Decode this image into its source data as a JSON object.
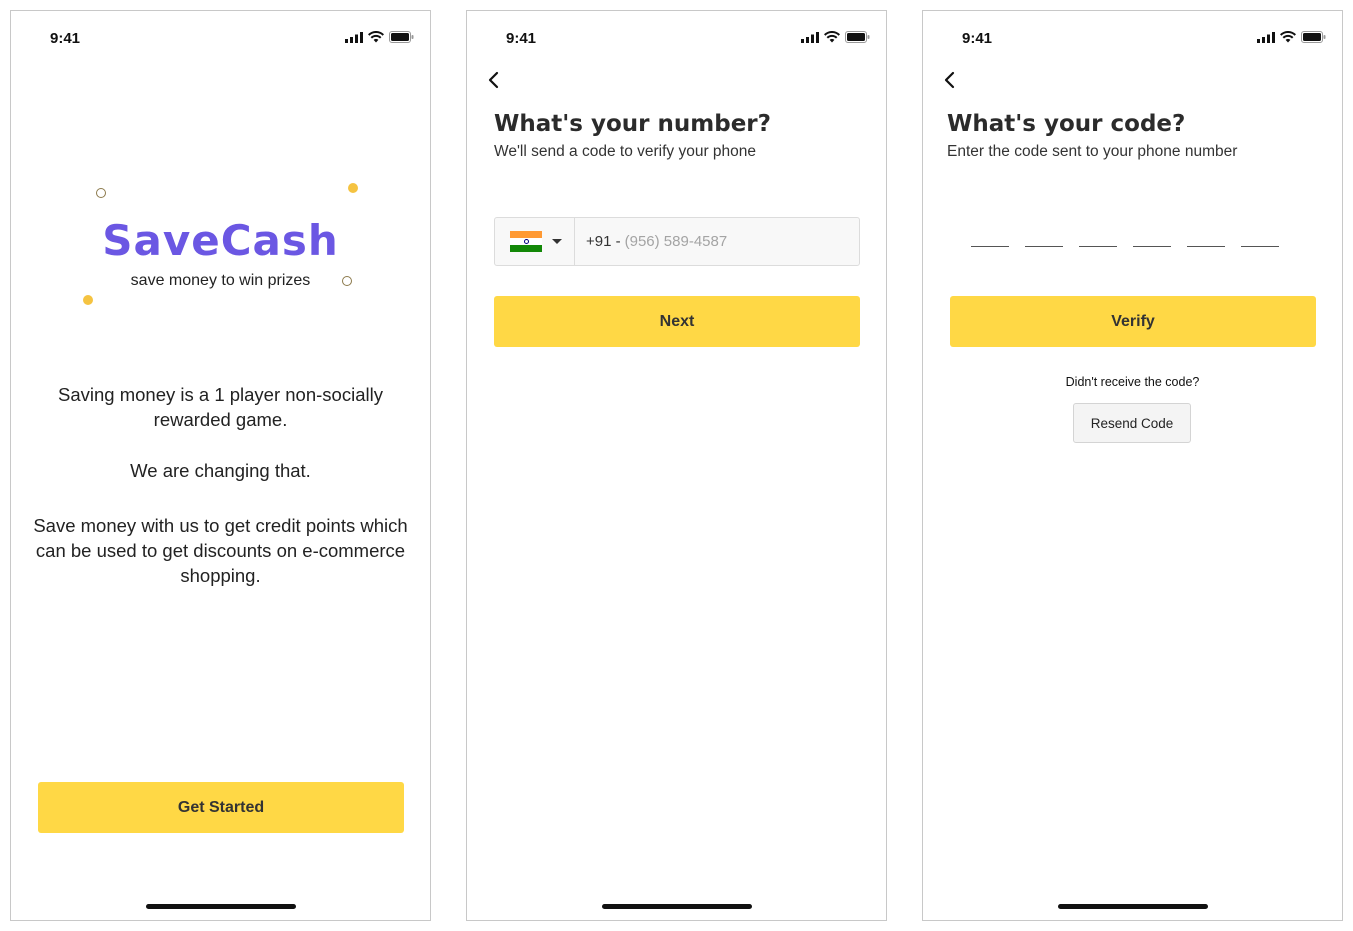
{
  "colors": {
    "brand": "#6b57e3",
    "accent_yellow": "#ffd845",
    "dot_yellow": "#f5c341",
    "dot_ring": "#8c7a4c",
    "flag_saffron": "#ff9933",
    "flag_white": "#ffffff",
    "flag_green": "#138808",
    "flag_chakra": "#000080"
  },
  "status_bar": {
    "time": "9:41",
    "icons": [
      "signal-icon",
      "wifi-icon",
      "battery-icon"
    ]
  },
  "welcome": {
    "brand_name": "SaveCash",
    "tagline": "save money to win prizes",
    "paragraphs": [
      "Saving money is a 1 player non-socially rewarded game.",
      "We are changing that.",
      "Save money with us to get credit points which can be used to get discounts on e-commerce shopping."
    ],
    "cta_label": "Get Started"
  },
  "phone_screen": {
    "back_icon": "chevron-left-icon",
    "heading": "What's your number?",
    "subheading": "We'll send a code to verify your phone",
    "country_flag": "india-flag-icon",
    "country_code": "+91 -",
    "phone_placeholder": "(956) 589-4587",
    "next_label": "Next"
  },
  "code_screen": {
    "back_icon": "chevron-left-icon",
    "heading": "What's your code?",
    "subheading": "Enter the code sent to your phone number",
    "code_length": 6,
    "verify_label": "Verify",
    "no_code_text": "Didn't receive the code?",
    "resend_label": "Resend Code"
  }
}
